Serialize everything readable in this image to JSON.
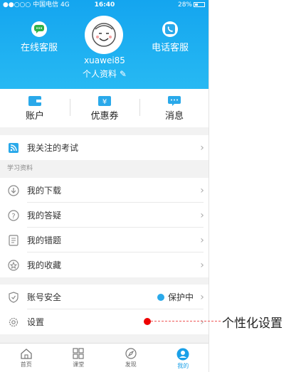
{
  "status_bar": {
    "carrier": "●●○○○ 中国电信  4G",
    "time": "16:40",
    "battery": "28%"
  },
  "header": {
    "online_service": "在线客服",
    "phone_service": "电话客服",
    "username": "xuawei85",
    "profile_label": "个人资料"
  },
  "quick_links": [
    "账户",
    "优惠券",
    "消息"
  ],
  "rows": {
    "followed_exams": "我关注的考试",
    "section_title": "学习资料",
    "downloads": "我的下载",
    "questions": "我的答疑",
    "mistakes": "我的错题",
    "favorites": "我的收藏",
    "security": "账号安全",
    "security_status": "保护中",
    "settings": "设置"
  },
  "tabbar": {
    "home": "首页",
    "classroom": "课堂",
    "discover": "发现",
    "mine": "我的"
  },
  "annotation": {
    "text": "个性化设置"
  },
  "colors": {
    "accent": "#1aa0e8",
    "annotation": "#e00000"
  }
}
